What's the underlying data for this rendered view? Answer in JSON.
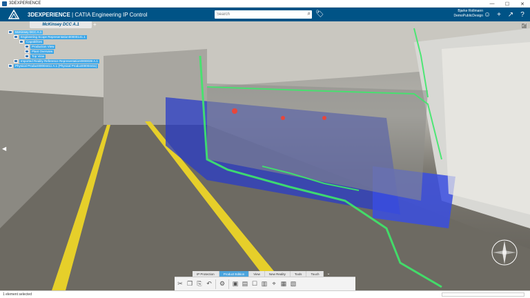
{
  "window": {
    "title": "3DEXPERIENCE",
    "minimize": "—",
    "maximize": "☐",
    "close": "✕"
  },
  "header": {
    "brand_bold": "3DEXPERIENCE",
    "brand_rest": " | CATIA Engineering IP Control",
    "search_placeholder": "Search",
    "user_name": "Bjarke Rollmann",
    "user_space": "DemoPublicDesign"
  },
  "document": {
    "tab_label": "McKinsey DCC A.1"
  },
  "tree": [
    {
      "label": "McKinsey DCC A.1",
      "level": 0,
      "state": "active"
    },
    {
      "label": "Engineering Scope Representation00000141.1",
      "level": 1,
      "state": "sel"
    },
    {
      "label": "Capabilities",
      "level": 2,
      "state": "sel"
    },
    {
      "label": "Production View",
      "level": 3,
      "state": "sel"
    },
    {
      "label": "Plant Overview",
      "level": 3,
      "state": "sel"
    },
    {
      "label": "Top View",
      "level": 3,
      "state": "sel"
    },
    {
      "label": "Imported Reality Reference Representation0000039 A.1",
      "level": 1,
      "state": "sel"
    },
    {
      "label": "Physical Product00004411 A.1 (Physical Product00004411)",
      "level": 0,
      "state": "sel"
    }
  ],
  "action_tabs": [
    "IP Protection",
    "Product Edition",
    "View",
    "New Reality",
    "Tools",
    "Touch"
  ],
  "active_action_tab": "Product Edition",
  "status": {
    "text": "1 element selected"
  },
  "colors": {
    "header": "#005386",
    "accent": "#3ba6e8",
    "pointcloud_green": "#3ee86a",
    "pointcloud_blue": "#2a3cc8",
    "floor_line": "#e6cf2a"
  }
}
